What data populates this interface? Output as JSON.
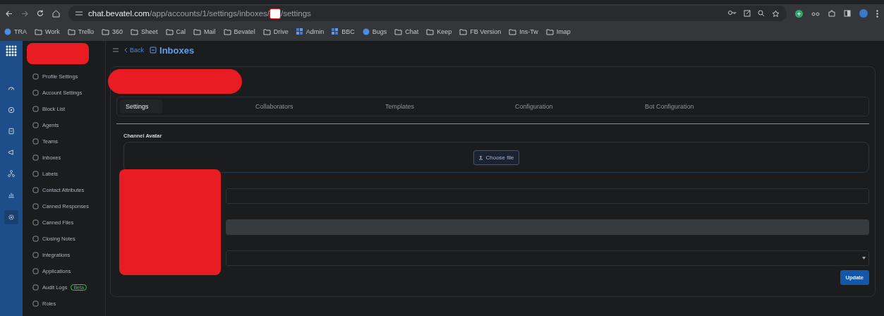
{
  "browser": {
    "url_host": "chat.bevatel.com",
    "url_path_before": "/app/accounts/1/settings/inboxes/",
    "url_path_after": "/settings",
    "bookmarks": [
      {
        "label": "TRA",
        "kind": "site"
      },
      {
        "label": "Work",
        "kind": "folder"
      },
      {
        "label": "Trello",
        "kind": "folder"
      },
      {
        "label": "360",
        "kind": "folder"
      },
      {
        "label": "Sheet",
        "kind": "folder"
      },
      {
        "label": "Cal",
        "kind": "folder"
      },
      {
        "label": "Mail",
        "kind": "folder"
      },
      {
        "label": "Bevatel",
        "kind": "folder"
      },
      {
        "label": "Drive",
        "kind": "folder"
      },
      {
        "label": "Admin",
        "kind": "grid"
      },
      {
        "label": "BBC",
        "kind": "grid"
      },
      {
        "label": "Bugs",
        "kind": "site"
      },
      {
        "label": "Chat",
        "kind": "folder"
      },
      {
        "label": "Keep",
        "kind": "folder"
      },
      {
        "label": "FB Version",
        "kind": "folder"
      },
      {
        "label": "Ins-Tw",
        "kind": "folder"
      },
      {
        "label": "Imap",
        "kind": "folder"
      }
    ]
  },
  "rail": [
    {
      "kind": "gauge",
      "selected": false
    },
    {
      "kind": "compass",
      "selected": false
    },
    {
      "kind": "book",
      "selected": false
    },
    {
      "kind": "megaphone",
      "selected": false
    },
    {
      "kind": "network",
      "selected": false
    },
    {
      "kind": "chart",
      "selected": false
    },
    {
      "kind": "gear",
      "selected": true
    }
  ],
  "sidebar": {
    "items": [
      {
        "label": "Profile Settings"
      },
      {
        "label": "Account Settings"
      },
      {
        "label": "Block List"
      },
      {
        "label": "Agents"
      },
      {
        "label": "Teams"
      },
      {
        "label": "Inboxes"
      },
      {
        "label": "Labels"
      },
      {
        "label": "Contact Attributes"
      },
      {
        "label": "Canned Responses"
      },
      {
        "label": "Canned Files"
      },
      {
        "label": "Closing Notes"
      },
      {
        "label": "Integrations"
      },
      {
        "label": "Applications"
      },
      {
        "label": "Audit Logs",
        "badge": "Beta"
      },
      {
        "label": "Roles"
      }
    ]
  },
  "header": {
    "back": "Back",
    "title": "Inboxes"
  },
  "tabs": [
    {
      "label": "Settings",
      "selected": true
    },
    {
      "label": "Collaborators",
      "selected": false
    },
    {
      "label": "Templates",
      "selected": false
    },
    {
      "label": "Configuration",
      "selected": false
    },
    {
      "label": "Bot Configuration",
      "selected": false
    }
  ],
  "form": {
    "avatar_label": "Channel Avatar",
    "choose_file": "Choose file",
    "fields": [
      {
        "kind": "input",
        "disabled": false
      },
      {
        "kind": "input",
        "disabled": true
      },
      {
        "kind": "select",
        "disabled": false
      }
    ],
    "submit": "Update"
  }
}
